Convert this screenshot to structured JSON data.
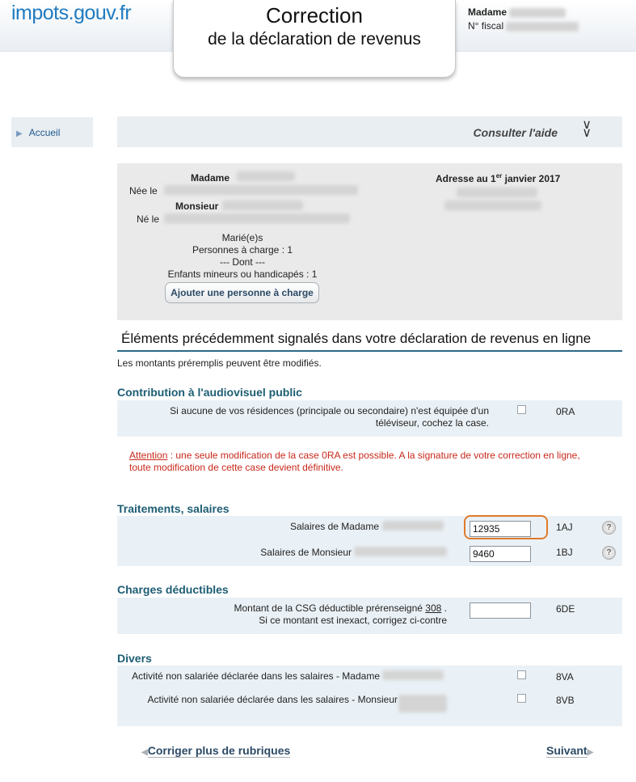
{
  "header": {
    "logo": "impots.gouv.fr",
    "title_line1": "Correction",
    "title_line2": "de la déclaration de revenus",
    "civility": "Madame",
    "fiscal_label": "N° fiscal"
  },
  "sidebar": {
    "items": [
      {
        "label": "Accueil"
      }
    ]
  },
  "helpbar": {
    "label": "Consulter l'aide",
    "icon": "double-chevron-down-icon"
  },
  "household": {
    "madame_label": "Madame",
    "nee_label": "Née le",
    "monsieur_label": "Monsieur",
    "ne_label": "Né le",
    "address_title": "Adresse au 1",
    "address_sup": "er",
    "address_date": " janvier 2017",
    "status": "Marié(e)s",
    "dependents": "Personnes à charge : 1",
    "dont": "--- Dont ---",
    "children": "Enfants mineurs ou handicapés : 1",
    "add_button": "Ajouter une personne à charge"
  },
  "section": {
    "title": "Éléments précédemment signalés dans votre déclaration de revenus en ligne",
    "subtitle": "Les montants préremplis peuvent être modifiés."
  },
  "audiovisuel": {
    "heading": "Contribution à l'audiovisuel public",
    "label_line1": "Si aucune de vos résidences (principale ou secondaire) n'est équipée d'un",
    "label_line2": "téléviseur, cochez la case.",
    "code": "0RA",
    "warning_word": "Attention",
    "warning_line1": " : une seule modification de la case 0RA est possible. A la signature de votre correction en ligne,",
    "warning_line2": "toute modification de cette case devient définitive."
  },
  "salaires": {
    "heading": "Traitements, salaires",
    "madame_label": "Salaires de Madame",
    "madame_value": "12935",
    "madame_code": "1AJ",
    "monsieur_label": "Salaires de Monsieur",
    "monsieur_value": "9460",
    "monsieur_code": "1BJ",
    "help_icon": "?"
  },
  "charges": {
    "heading": "Charges déductibles",
    "label_line1": "Montant de la CSG déductible prérenseigné",
    "csg_value": "308",
    "label_line2": "Si ce montant est inexact, corrigez ci-contre",
    "input_value": "",
    "code": "6DE"
  },
  "divers": {
    "heading": "Divers",
    "row1_label": "Activité non salariée déclarée dans les salaires - Madame",
    "row1_code": "8VA",
    "row2_label": "Activité non salariée déclarée dans les salaires - Monsieur",
    "row2_code": "8VB"
  },
  "footer": {
    "prev_label": "Corriger plus de rubriques",
    "next_label": "Suivant"
  }
}
